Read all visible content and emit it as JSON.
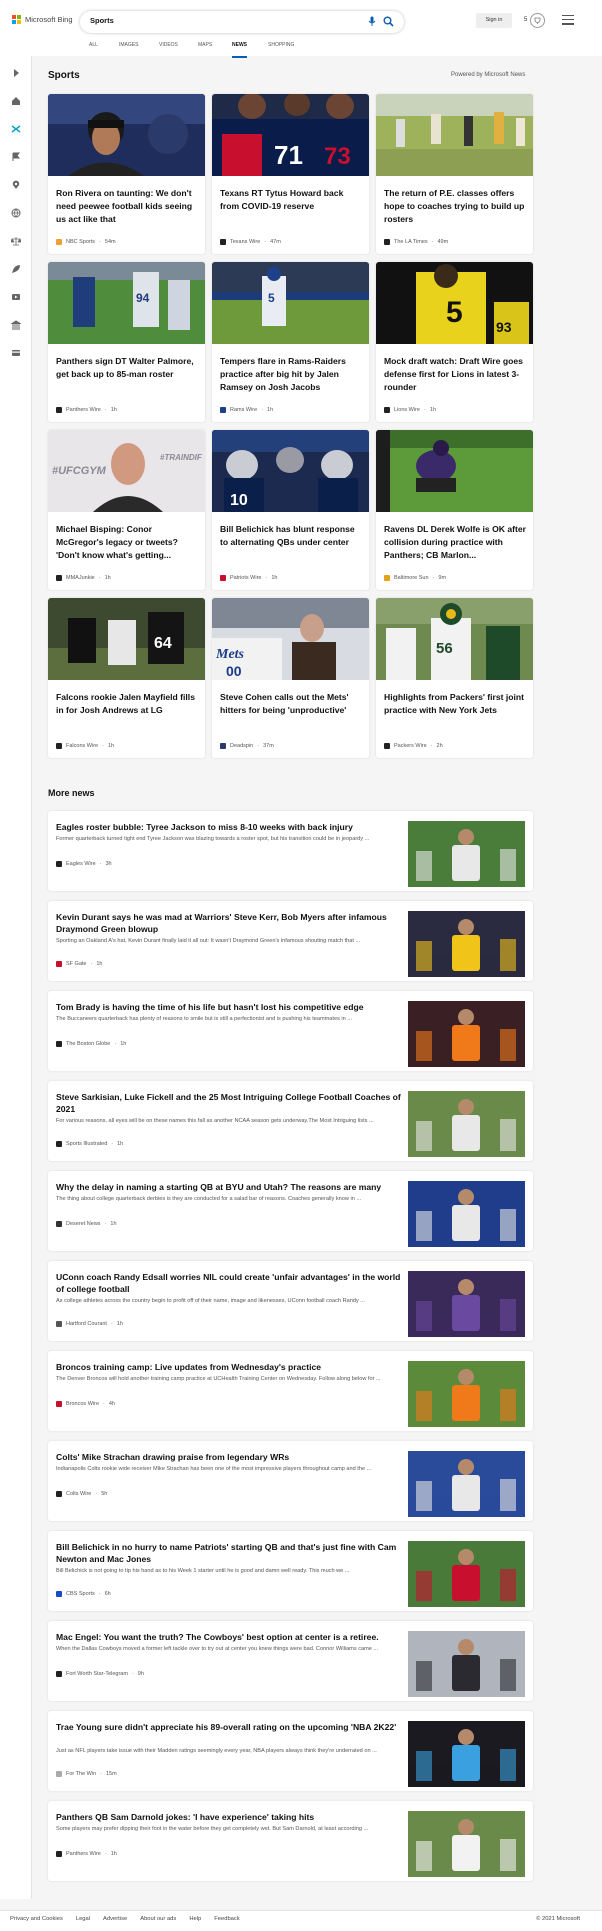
{
  "header": {
    "logo_text": "Microsoft Bing",
    "search_value": "Sports",
    "signin_label": "Sign in",
    "rewards_points": "5",
    "tabs": [
      {
        "label": "ALL",
        "active": false
      },
      {
        "label": "IMAGES",
        "active": false
      },
      {
        "label": "VIDEOS",
        "active": false
      },
      {
        "label": "MAPS",
        "active": false
      },
      {
        "label": "NEWS",
        "active": true
      },
      {
        "label": "SHOPPING",
        "active": false
      }
    ]
  },
  "colors": {
    "accent": "#0c5bb5",
    "ms_red": "#f25022",
    "ms_green": "#7fba00",
    "ms_blue": "#00a4ef",
    "ms_yellow": "#ffb900"
  },
  "rail_icons": [
    "expand-icon",
    "home-icon",
    "shuffle-icon",
    "flag-icon",
    "location-icon",
    "globe-icon",
    "scale-icon",
    "rocket-icon",
    "video-icon",
    "bank-icon",
    "card-icon"
  ],
  "sports": {
    "title": "Sports",
    "powered_by": "Powered by Microsoft News",
    "cards": [
      {
        "title": "Ron Rivera on taunting: We don't need peewee football kids seeing us act like that",
        "source": "NBC Sports",
        "time": "54m"
      },
      {
        "title": "Texans RT Tytus Howard back from COVID-19 reserve",
        "source": "Texans Wire",
        "time": "47m"
      },
      {
        "title": "The return of P.E. classes offers hope to coaches trying to build up rosters",
        "source": "The LA Times",
        "time": "49m"
      },
      {
        "title": "Panthers sign DT Walter Palmore, get back up to 85-man roster",
        "source": "Panthers Wire",
        "time": "1h"
      },
      {
        "title": "Tempers flare in Rams-Raiders practice after big hit by Jalen Ramsey on Josh Jacobs",
        "source": "Rams Wire",
        "time": "1h"
      },
      {
        "title": "Mock draft watch: Draft Wire goes defense first for Lions in latest 3-rounder",
        "source": "Lions Wire",
        "time": "1h"
      },
      {
        "title": "Michael Bisping: Conor McGregor's legacy or tweets? 'Don't know what's getting...",
        "source": "MMAJunkie",
        "time": "1h"
      },
      {
        "title": "Bill Belichick has blunt response to alternating QBs under center",
        "source": "Patriots Wire",
        "time": "1h"
      },
      {
        "title": "Ravens DL Derek Wolfe is OK after collision during practice with Panthers; CB Marlon...",
        "source": "Baltimore Sun",
        "time": "9m"
      },
      {
        "title": "Falcons rookie Jalen Mayfield fills in for Josh Andrews at LG",
        "source": "Falcons Wire",
        "time": "1h"
      },
      {
        "title": "Steve Cohen calls out the Mets' hitters for being 'unproductive'",
        "source": "Deadspin",
        "time": "37m"
      },
      {
        "title": "Highlights from Packers' first joint practice with New York Jets",
        "source": "Packers Wire",
        "time": "2h"
      }
    ]
  },
  "more_news": {
    "title": "More news",
    "items": [
      {
        "title": "Eagles roster bubble: Tyree Jackson to miss 8-10 weeks with back injury",
        "snippet": "Former quarterback turned tight end Tyree Jackson was blazing towards a roster spot, but his transition could be in jeopardy ...",
        "source": "Eagles Wire",
        "time": "3h"
      },
      {
        "title": "Kevin Durant says he was mad at Warriors' Steve Kerr, Bob Myers after infamous Draymond Green blowup",
        "snippet": "Sporting an Oakland A's hat, Kevin Durant finally laid it all out: It wasn't Draymond Green's infamous shouting match that ...",
        "source": "SF Gate",
        "time": "1h"
      },
      {
        "title": "Tom Brady is having the time of his life but hasn't lost his competitive edge",
        "snippet": "The Buccaneers quarterback has plenty of reasons to smile but is still a perfectionist and is pushing his teammates in ...",
        "source": "The Boston Globe",
        "time": "1h"
      },
      {
        "title": "Steve Sarkisian, Luke Fickell and the 25 Most Intriguing College Football Coaches of 2021",
        "snippet": "For various reasons, all eyes will be on these names this fall as another NCAA season gets underway.The Most Intriguing lists ...",
        "source": "Sports Illustrated",
        "time": "1h"
      },
      {
        "title": "Why the delay in naming a starting QB at BYU and Utah? The reasons are many",
        "snippet": "The thing about college quarterback derbies is they are conducted for a salad bar of reasons. Coaches generally know in ...",
        "source": "Deseret News",
        "time": "1h"
      },
      {
        "title": "UConn coach Randy Edsall worries NIL could create 'unfair advantages' in the world of college football",
        "snippet": "As college athletes across the country begin to profit off of their name, image and likenesses, UConn football coach Randy ...",
        "source": "Hartford Courant",
        "time": "1h"
      },
      {
        "title": "Broncos training camp: Live updates from Wednesday's practice",
        "snippet": "The Denver Broncos will hold another training camp practice at UCHealth Training Center on Wednesday. Follow along below for ...",
        "source": "Broncos Wire",
        "time": "4h"
      },
      {
        "title": "Colts' Mike Strachan drawing praise from legendary WRs",
        "snippet": "Indianapolis Colts rookie wide receiver Mike Strachan has been one of the most impressive players throughout camp and the ...",
        "source": "Colts Wire",
        "time": "5h"
      },
      {
        "title": "Bill Belichick in no hurry to name Patriots' starting QB and that's just fine with Cam Newton and Mac Jones",
        "snippet": "Bill Belichick is not going to tip his hand as to his Week 1 starter until he is good and damn well ready. This much we ...",
        "source": "CBS Sports",
        "time": "6h"
      },
      {
        "title": "Mac Engel: You want the truth? The Cowboys' best option at center is a retiree.",
        "snippet": "When the Dallas Cowboys moved a former left tackle over to try out at center you knew things were bad. Connor Williams came ...",
        "source": "Fort Worth Star-Telegram",
        "time": "9h"
      },
      {
        "title": "Trae Young sure didn't appreciate his 89-overall rating on the upcoming 'NBA 2K22'",
        "snippet": "Just as NFL players take issue with their Madden ratings seemingly every year, NBA players always think they're underrated on ...",
        "source": "For The Win",
        "time": "15m"
      },
      {
        "title": "Panthers QB Sam Darnold jokes: 'I have experience' taking hits",
        "snippet": "Some players may prefer dipping their foot in the water before they get completely wet. But Sam Darnold, at least according ...",
        "source": "Panthers Wire",
        "time": "1h"
      }
    ]
  },
  "footer": {
    "links": [
      "Privacy and Cookies",
      "Legal",
      "Advertise",
      "About our ads",
      "Help",
      "Feedback"
    ],
    "copyright": "© 2021 Microsoft"
  }
}
